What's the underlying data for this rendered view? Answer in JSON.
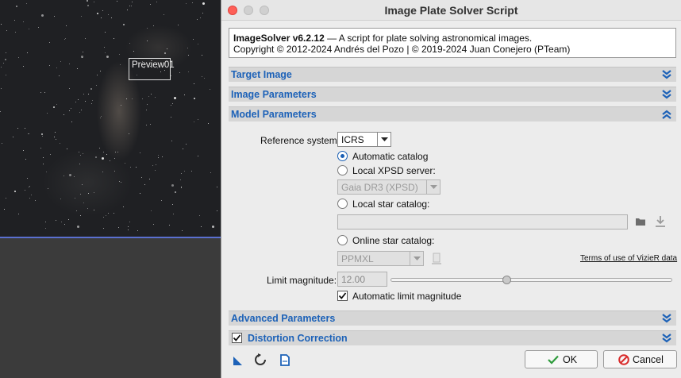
{
  "image_view": {
    "preview_label": "Preview01"
  },
  "dialog": {
    "title": "Image Plate Solver Script",
    "info": {
      "name_version": "ImageSolver v6.2.12",
      "description": " — A script for plate solving astronomical images.",
      "copyright": "Copyright © 2012-2024 Andrés del Pozo | © 2019-2024 Juan Conejero (PTeam)"
    },
    "sections": {
      "target_image": "Target Image",
      "image_parameters": "Image Parameters",
      "model_parameters": "Model Parameters",
      "advanced_parameters": "Advanced Parameters",
      "distortion_correction": "Distortion Correction"
    },
    "model": {
      "reference_system_label": "Reference system:",
      "reference_system_value": "ICRS",
      "automatic_catalog_label": "Automatic catalog",
      "local_xpsd_label": "Local XPSD server:",
      "local_xpsd_value": "Gaia DR3 (XPSD)",
      "local_star_catalog_label": "Local star catalog:",
      "local_star_catalog_path": "",
      "online_star_catalog_label": "Online star catalog:",
      "online_catalog_value": "PPMXL",
      "vizier_terms_link": "Terms of use of VizieR data",
      "limit_magnitude_label": "Limit magnitude:",
      "limit_magnitude_value": "12.00",
      "limit_magnitude_slider_fraction": 0.41,
      "automatic_limit_label": "Automatic limit magnitude",
      "selected_catalog": "automatic",
      "automatic_limit_checked": true
    },
    "distortion_correction_checked": true,
    "buttons": {
      "ok": "OK",
      "cancel": "Cancel"
    },
    "colors": {
      "section_text": "#1d62b8",
      "close_red": "#fe5f57",
      "cancel_icon": "#d92b2b",
      "ok_icon": "#2e9b3c"
    }
  }
}
